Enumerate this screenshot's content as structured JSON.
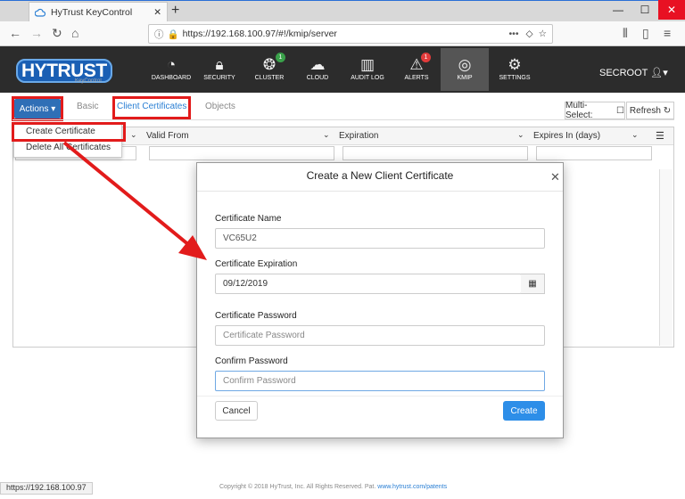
{
  "browser": {
    "tab_title": "HyTrust KeyControl",
    "url": "https://192.168.100.97/#!/kmip/server",
    "url_dots": "•••"
  },
  "app": {
    "logo": "HYTRUST",
    "logo_sub": "KeyControl",
    "nav": [
      {
        "label": "DASHBOARD",
        "icon": "dashboard-icon"
      },
      {
        "label": "SECURITY",
        "icon": "lock-icon"
      },
      {
        "label": "CLUSTER",
        "icon": "cluster-icon",
        "badge": "1"
      },
      {
        "label": "CLOUD",
        "icon": "cloud-icon"
      },
      {
        "label": "AUDIT LOG",
        "icon": "book-icon"
      },
      {
        "label": "ALERTS",
        "icon": "alert-icon",
        "badge": "1"
      },
      {
        "label": "KMIP",
        "icon": "fingerprint-icon"
      },
      {
        "label": "SETTINGS",
        "icon": "gear-icon"
      }
    ],
    "user": "SECROOT"
  },
  "tabs": {
    "actions": "Actions",
    "basic": "Basic",
    "client_certificates": "Client Certificates",
    "objects": "Objects",
    "multiselect": "Multi-Select:",
    "refresh": "Refresh"
  },
  "dropdown": {
    "create": "Create Certificate",
    "delete": "Delete All Certificates"
  },
  "grid": {
    "columns": [
      "Valid From",
      "Expiration",
      "Expires In (days)"
    ]
  },
  "modal": {
    "title": "Create a New Client Certificate",
    "name_label": "Certificate Name",
    "name_value": "VC65U2",
    "exp_label": "Certificate Expiration",
    "exp_value": "09/12/2019",
    "pw_label": "Certificate Password",
    "pw_placeholder": "Certificate Password",
    "confirm_label": "Confirm Password",
    "confirm_placeholder": "Confirm Password",
    "cancel": "Cancel",
    "create": "Create"
  },
  "footer": {
    "status_url": "https://192.168.100.97",
    "copyright": "Copyright © 2018 HyTrust, Inc. All Rights Reserved. Pat.",
    "link": "www.hytrust.com/patents"
  },
  "colors": {
    "accent": "#2f6fb6",
    "highlight": "#e21b1b",
    "create": "#2d8ee8"
  }
}
